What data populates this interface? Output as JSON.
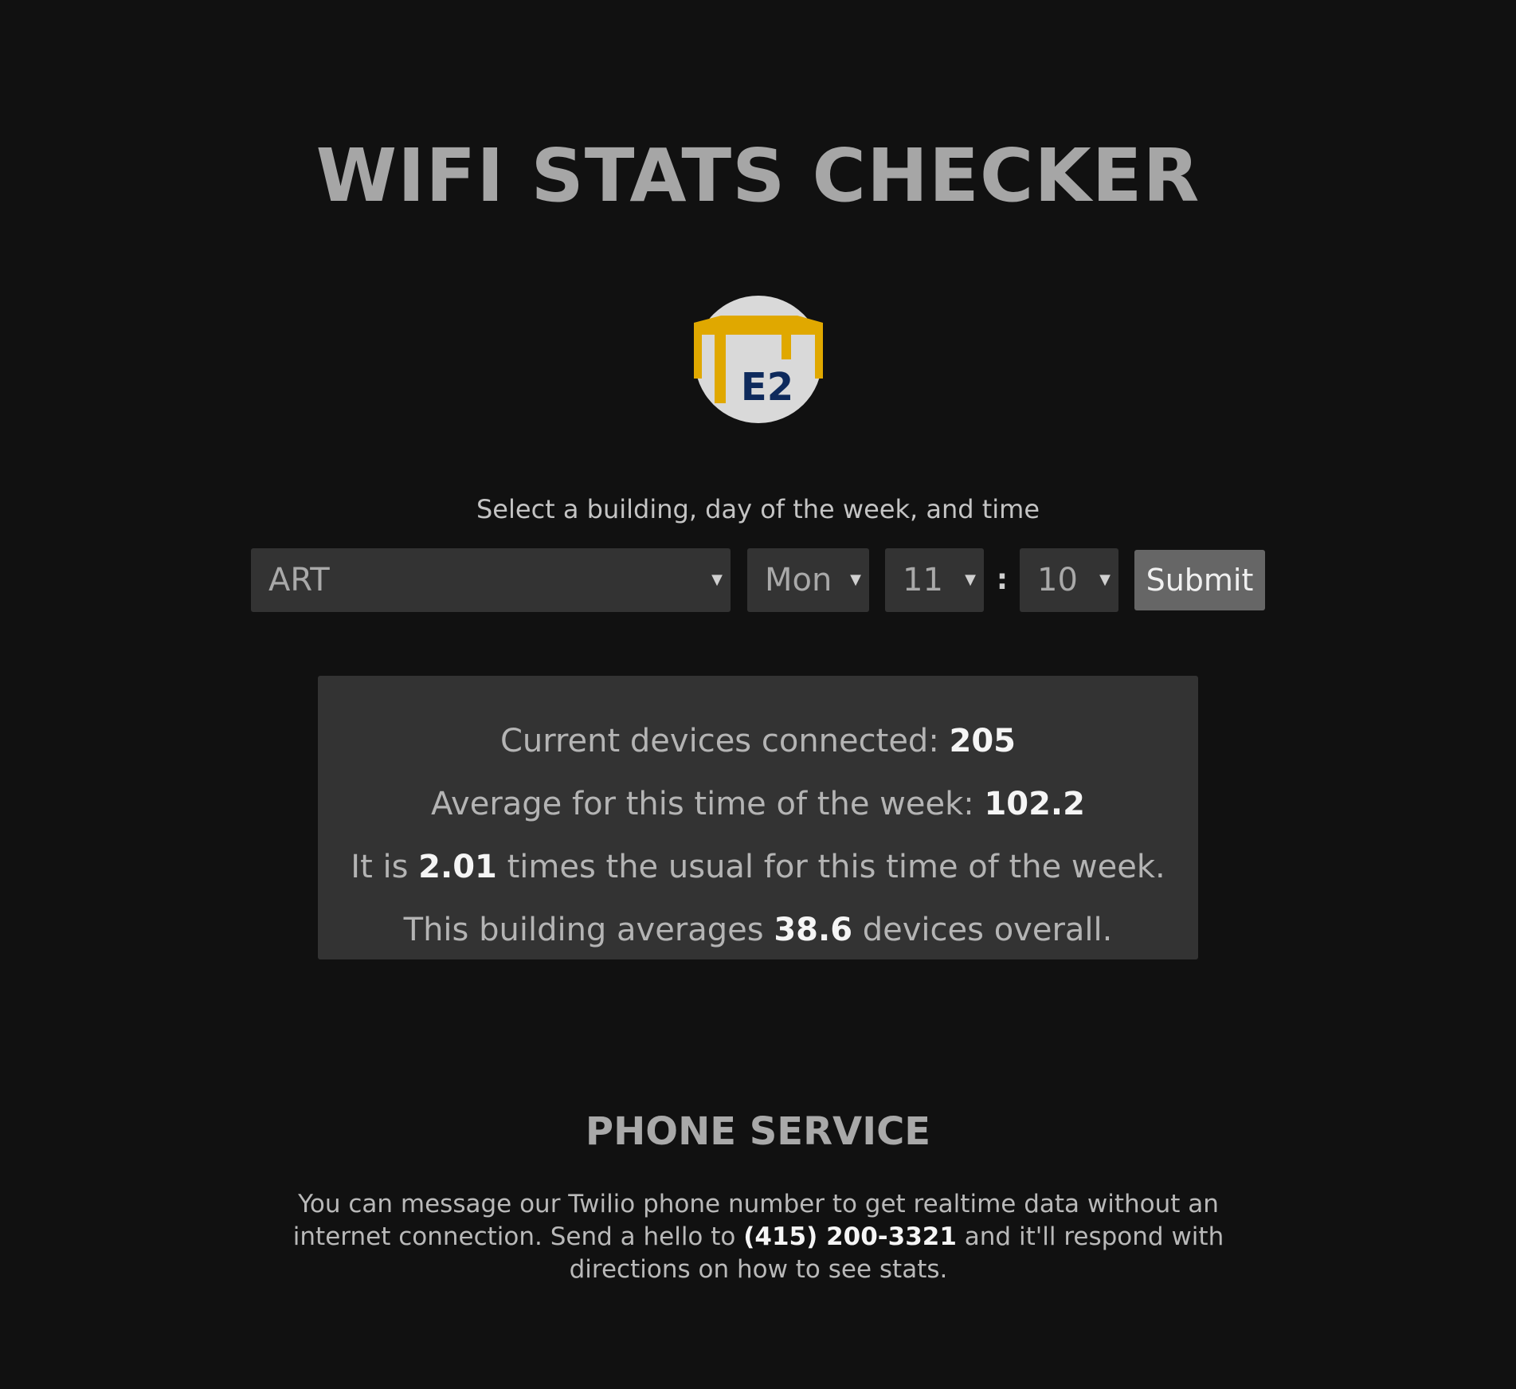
{
  "header": {
    "title": "WIFI STATS CHECKER"
  },
  "logo": {
    "icon": "e2-table-logo-icon",
    "text": "E2",
    "colors": {
      "circle": "#d9d9d9",
      "table": "#e0a800",
      "text": "#0e2a5c"
    }
  },
  "form": {
    "prompt": "Select a building, day of the week, and time",
    "building": "ART",
    "day": "Mon",
    "hour": "11",
    "separator": ":",
    "minute": "10",
    "submit_label": "Submit"
  },
  "stats": {
    "line1_prefix": "Current devices connected: ",
    "current_devices": "205",
    "line2_prefix": "Average for this time of the week: ",
    "average_this_time": "102.2",
    "line3_prefix": "It is ",
    "ratio": "2.01",
    "line3_suffix": " times the usual for this time of the week.",
    "line4_prefix": "This building averages ",
    "overall_average": "38.6",
    "line4_suffix": " devices overall."
  },
  "phone": {
    "heading": "PHONE SERVICE",
    "text_before": "You can message our Twilio phone number to get realtime data without an internet connection. Send a hello to ",
    "number": "(415) 200-3321",
    "text_after": " and it'll respond with directions on how to see stats."
  },
  "colors": {
    "background": "#111111",
    "panel": "#333333",
    "button": "#666666"
  }
}
